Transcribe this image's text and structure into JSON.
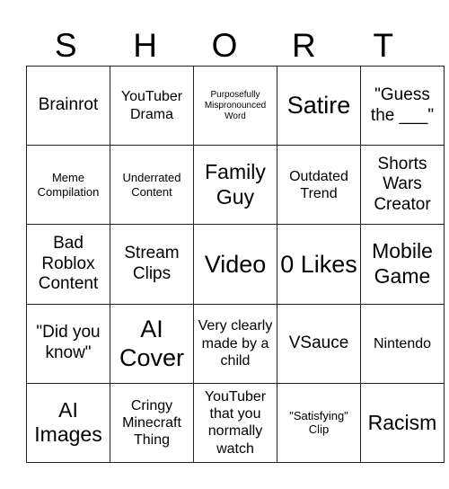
{
  "header": {
    "letters": [
      "S",
      "H",
      "O",
      "R",
      "T"
    ]
  },
  "board": {
    "rows": [
      [
        {
          "text": "Brainrot",
          "size": "lg"
        },
        {
          "text": "YouTuber Drama",
          "size": "md"
        },
        {
          "text": "Purposefully Mispronounced Word",
          "size": "xs"
        },
        {
          "text": "Satire",
          "size": "xxl"
        },
        {
          "text": "\"Guess the ___\"",
          "size": "lg"
        }
      ],
      [
        {
          "text": "Meme Compilation",
          "size": "sm"
        },
        {
          "text": "Underrated Content",
          "size": "sm"
        },
        {
          "text": "Family Guy",
          "size": "xl"
        },
        {
          "text": "Outdated Trend",
          "size": "md"
        },
        {
          "text": "Shorts Wars Creator",
          "size": "lg"
        }
      ],
      [
        {
          "text": "Bad Roblox Content",
          "size": "lg"
        },
        {
          "text": "Stream Clips",
          "size": "lg"
        },
        {
          "text": "Video",
          "size": "xxl"
        },
        {
          "text": "0 Likes",
          "size": "xxl"
        },
        {
          "text": "Mobile Game",
          "size": "xl"
        }
      ],
      [
        {
          "text": "\"Did you know\"",
          "size": "lg"
        },
        {
          "text": "AI Cover",
          "size": "xxl"
        },
        {
          "text": "Very clearly made by a child",
          "size": "md"
        },
        {
          "text": "VSauce",
          "size": "lg"
        },
        {
          "text": "Nintendo",
          "size": "md"
        }
      ],
      [
        {
          "text": "AI Images",
          "size": "xl"
        },
        {
          "text": "Cringy Minecraft Thing",
          "size": "md"
        },
        {
          "text": "YouTuber that you normally watch",
          "size": "md"
        },
        {
          "text": "\"Satisfying\" Clip",
          "size": "sm"
        },
        {
          "text": "Racism",
          "size": "xl"
        }
      ]
    ]
  }
}
